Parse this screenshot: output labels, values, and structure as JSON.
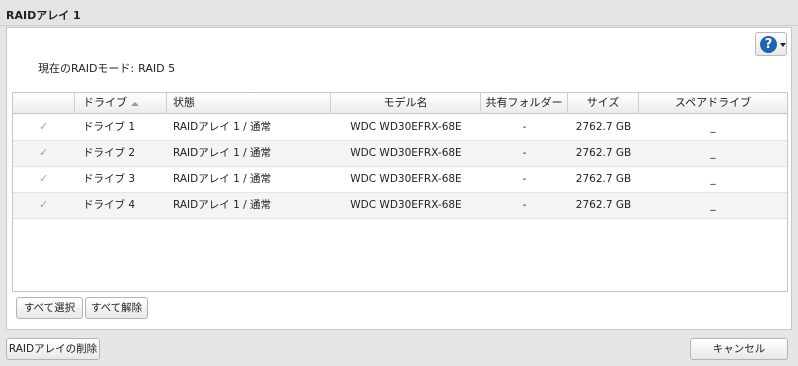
{
  "window": {
    "title": "RAIDアレイ 1"
  },
  "help": {
    "symbol": "?"
  },
  "mode": {
    "label": "現在のRAIDモード:",
    "value": "RAID 5"
  },
  "table": {
    "columns": {
      "drive": "ドライブ",
      "status": "状態",
      "model": "モデル名",
      "shared": "共有フォルダー",
      "size": "サイズ",
      "spare": "スペアドライブ"
    },
    "rows": [
      {
        "checked": "✓",
        "drive": "ドライブ 1",
        "status": "RAIDアレイ 1 / 通常",
        "model": "WDC WD30EFRX-68E",
        "shared": "-",
        "size": "2762.7 GB",
        "spare": "_"
      },
      {
        "checked": "✓",
        "drive": "ドライブ 2",
        "status": "RAIDアレイ 1 / 通常",
        "model": "WDC WD30EFRX-68E",
        "shared": "-",
        "size": "2762.7 GB",
        "spare": "_"
      },
      {
        "checked": "✓",
        "drive": "ドライブ 3",
        "status": "RAIDアレイ 1 / 通常",
        "model": "WDC WD30EFRX-68E",
        "shared": "-",
        "size": "2762.7 GB",
        "spare": "_"
      },
      {
        "checked": "✓",
        "drive": "ドライブ 4",
        "status": "RAIDアレイ 1 / 通常",
        "model": "WDC WD30EFRX-68E",
        "shared": "-",
        "size": "2762.7 GB",
        "spare": "_"
      }
    ]
  },
  "actions": {
    "select_all": "すべて選択",
    "deselect_all": "すべて解除"
  },
  "footer": {
    "delete_raid": "RAIDアレイの削除",
    "cancel": "キャンセル"
  }
}
